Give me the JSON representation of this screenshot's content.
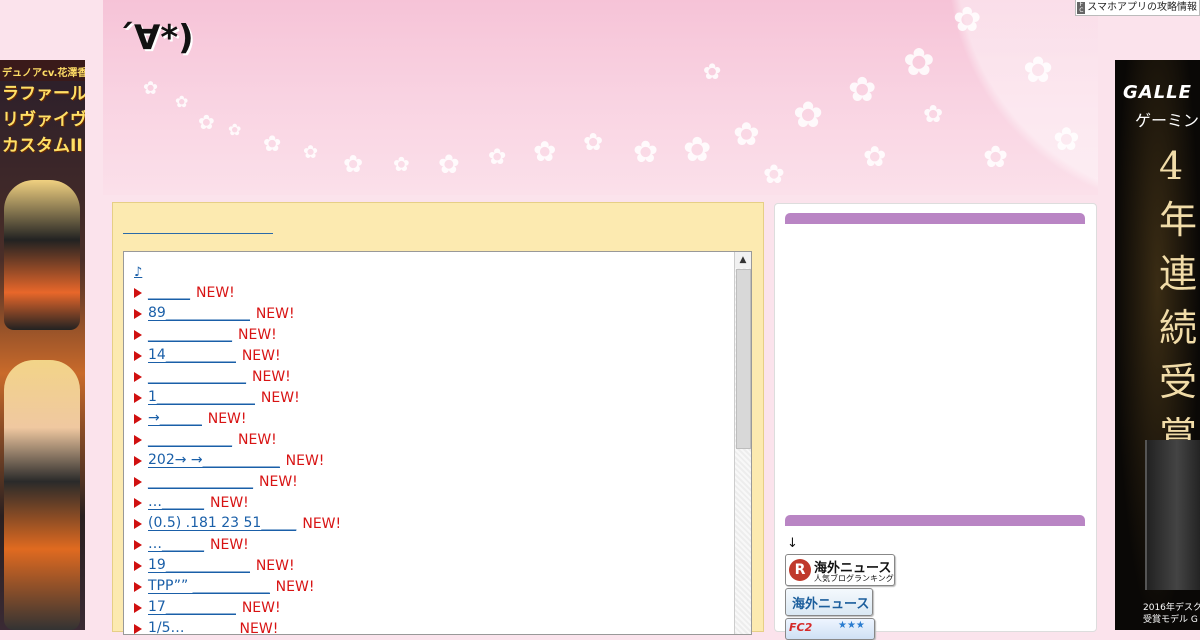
{
  "app_link": {
    "label": "スマホアプリの攻略情報"
  },
  "header": {
    "title": "´∀*)"
  },
  "ads": {
    "left": {
      "head": "デュノアcv.花澤香菜",
      "title_lines": [
        "ラファール",
        "リヴァイヴ",
        "カスタムII"
      ]
    },
    "right": {
      "brand": "GALLE",
      "subtitle": "ゲーミン",
      "award_chars": [
        "4",
        "年",
        "連",
        "続",
        "受",
        "賞"
      ],
      "foot_lines": [
        "2016年デスク",
        "受賞モデル G"
      ]
    }
  },
  "list": {
    "note": "♪",
    "new_label": "NEW!",
    "items": [
      {
        "label": "______"
      },
      {
        "label": "89____________"
      },
      {
        "label": "____________"
      },
      {
        "label": "14__________"
      },
      {
        "label": "______________"
      },
      {
        "label": "1______________"
      },
      {
        "label": "→______"
      },
      {
        "label": "____________"
      },
      {
        "label": "202→ →___________"
      },
      {
        "label": "_______________"
      },
      {
        "label": "…______"
      },
      {
        "label": "(0.5) .181 23 51_____"
      },
      {
        "label": "…______"
      },
      {
        "label": "19____________"
      },
      {
        "label": "TPP”” ___________"
      },
      {
        "label": "17__________"
      },
      {
        "label": "1/5…_______"
      }
    ]
  },
  "sidebar": {
    "arrow": "↓",
    "badge_ranking": {
      "icon": "R",
      "title": "海外ニュース",
      "subtitle": "人気ブログランキング"
    },
    "badge_news": {
      "title": "海外ニュース"
    },
    "badge_fc2": {
      "title": "FC2",
      "stars": "★★★"
    }
  }
}
